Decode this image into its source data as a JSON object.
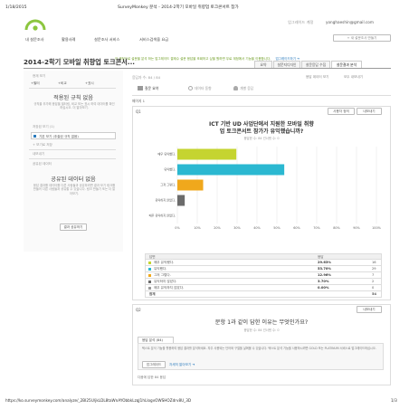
{
  "browser": {
    "date": "1/18/2015",
    "page_title": "SurveyMonkey 분석 - 2014-2학기 모바일 취향업 토크콘서트 참가",
    "footer_url": "https://ko.surveymonkey.com/analyze/_2BI25U/jkLDL8taWnAYObbkLzqJ1hLlogvOWSHOZdrv8U_3D",
    "footer_page": "1/3"
  },
  "header": {
    "account_link": "업그레이드 계정",
    "user_email": "yonghaeshin@gmail.com",
    "logo_alt": "SurveyMonkey"
  },
  "nav": {
    "items": [
      "내 설문조사",
      "활용사례",
      "설문조사 서비스",
      "서비스검색을 요금"
    ],
    "create_button": "+ 새 설문조사 만들기"
  },
  "banner": {
    "text": "이 계정으로 설문을 분석 하는 업그레이드 결제수 설문 응답을 조회하고 싶을 원하면 무료 계정에서 기능을 이용합니다.",
    "link": "업그레이드하기 ➜"
  },
  "survey": {
    "title": "2014-2학기 모바일 취향업 토크콘서...",
    "tabs": [
      "요약",
      "설문지디자인",
      "설문응답 수집",
      "설문결과 분석"
    ]
  },
  "sidebar": {
    "current_view_label": "현재 보기",
    "view_buttons": [
      "+필터",
      "+비교",
      "+표시"
    ],
    "no_rules_title": "적용된 규칙 없음",
    "no_rules_desc": "규칙을 추가해 응답을 필터링, 비교 또는 표시 하여 데이터를 확인하십시오. 더 알아보기.",
    "saved_views_label": "저장된 보기 (1)",
    "saved_view_item": "기본 보기 (추출된 규칙 없음)",
    "save_as_label": "+ 보기로 저장",
    "export_label": "내보내기",
    "shared_data_label": "공유된 데이터",
    "no_shared_title": "공유된 데이터 없음",
    "no_shared_desc": "응답 결과를 데이터를 다른 사람들과 공유하려면 결과 보기 링크를 만들어 다른 사람들과 공유할 수 있습니다. 링크 만들기 또는 더 알아보기.",
    "share_button": "결과 공유하기"
  },
  "content": {
    "responses_label": "응답자 수: 84 / 84",
    "responses_link": "응답 데이터 보기",
    "export_all_link": "모두 내보내기",
    "view_tabs": [
      "질문 요약",
      "데이터 동향",
      "개별 응답"
    ],
    "page_label": "페이지 1"
  },
  "q1": {
    "number": "Q1",
    "customize_button": "사용자 정의",
    "export_button": "내보내기",
    "title_line1": "ICT 기반 UD 사업단에서 지원한 모바일 취향",
    "title_line2": "업 토크콘서트 참가가 유익했습니까?",
    "meta": "응답한 수: 84   건너뛴 수: 0"
  },
  "q2": {
    "number": "Q2",
    "export_button": "내보내기",
    "title": "문항 1과 같이 답한 이유는 무엇인가요?",
    "meta": "응답한 수: 84   건너뛴 수: 0",
    "text_tab": "응답 분석 (84)",
    "desc": "텍스트 분석 기능을 활용하여 응답 결과를 분석하세요. 자주 사용되는 단어와 구절을 살펴볼 수 있습니다. 텍스트 분석 기능을 사용하시려면 GOLD 또는 PLATINUM 서비스로 업그레이드하십시오.",
    "upgrade_button": "업그레이드",
    "learn_more": "자세히 알아보기 ➜",
    "answered_footer": "다음에 답한 84 응답"
  },
  "chart_data": {
    "type": "bar",
    "orientation": "horizontal",
    "categories": [
      "매우 유익했다.",
      "유익했다.",
      "그저 그렇다.",
      "유익하지 않았다.",
      "매우 유익하지 않았다."
    ],
    "values": [
      29.63,
      53.7,
      12.96,
      3.7,
      0.0
    ],
    "colors": [
      "#c5d430",
      "#2bb8d1",
      "#f0a81c",
      "#6b6b6b",
      "#999999"
    ],
    "xlim": [
      0,
      100
    ],
    "ticks": [
      "0%",
      "10%",
      "20%",
      "30%",
      "40%",
      "50%",
      "60%",
      "70%",
      "80%",
      "90%",
      "100%"
    ],
    "table_headers": [
      "답변",
      "응답",
      ""
    ],
    "table_rows": [
      {
        "label": "매우 유익했다.",
        "pct": "29.63%",
        "count": "16"
      },
      {
        "label": "유익했다.",
        "pct": "53.70%",
        "count": "29"
      },
      {
        "label": "그저 그렇다.",
        "pct": "12.96%",
        "count": "7"
      },
      {
        "label": "유익하지 않았다.",
        "pct": "3.70%",
        "count": "2"
      },
      {
        "label": "매우 유익하지 않았다.",
        "pct": "0.00%",
        "count": "0"
      }
    ],
    "total_label": "합계",
    "total": "54"
  }
}
